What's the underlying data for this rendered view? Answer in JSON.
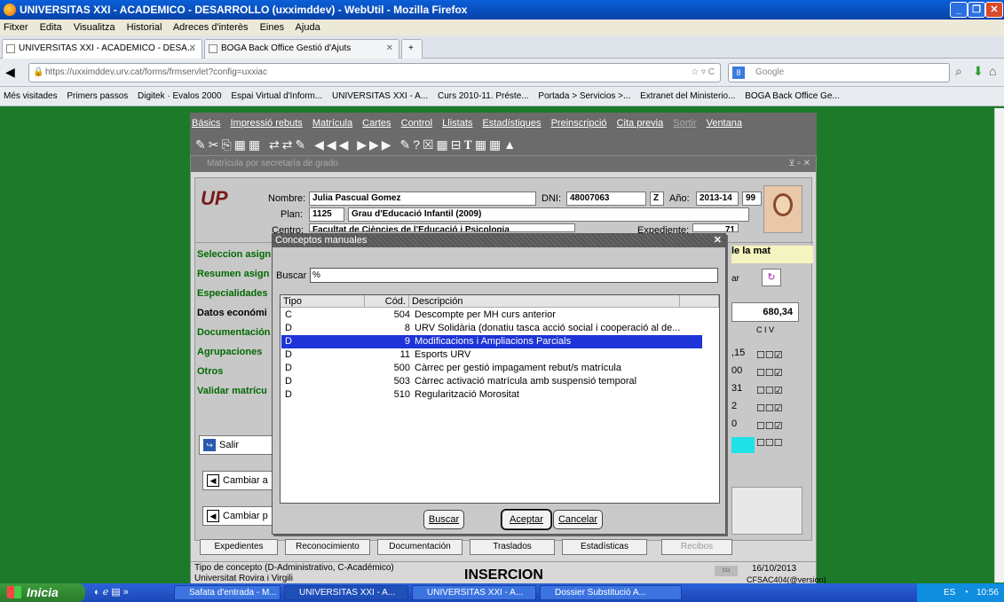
{
  "window": {
    "title": "UNIVERSITAS XXI - ACADEMICO - DESARROLLO (uxximddev) - WebUtil - Mozilla Firefox"
  },
  "browser_menu": [
    "Fitxer",
    "Edita",
    "Visualitza",
    "Historial",
    "Adreces d'interès",
    "Eines",
    "Ajuda"
  ],
  "tabs": [
    {
      "label": "UNIVERSITAS XXI - ACADEMICO - DESA..."
    },
    {
      "label": "BOGA  Back Office Gestió d'Ajuts"
    }
  ],
  "url": "https://uxximddev.urv.cat/forms/frmservlet?config=uxxiac",
  "search_placeholder": "Google",
  "bookmarks": [
    "Més visitades",
    "Primers passos",
    "Digitek · Evalos 2000",
    "Espai Virtual d'Inform...",
    "UNIVERSITAS XXI - A...",
    "Curs 2010-11. Préste...",
    "Portada > Servicios >...",
    "Extranet del Ministerio...",
    "BOGA  Back Office Ge..."
  ],
  "app_menu": [
    "Básics",
    "Impressió rebuts",
    "Matrícula",
    "Cartes",
    "Control",
    "Llistats",
    "Estadístiques",
    "Preinscripció",
    "Cita previa",
    "Sortir",
    "Ventana"
  ],
  "form": {
    "title": "Matrícula por secretaría de grado",
    "nombre_label": "Nombre:",
    "nombre": "Julia Pascual Gomez",
    "dni_label": "DNI:",
    "dni": "48007063",
    "dni_letter": "Z",
    "ano_label": "Año:",
    "ano": "2013-14",
    "ano_extra": "99",
    "plan_label": "Plan:",
    "plan_code": "1125",
    "plan_name": "Grau d'Educació Infantil (2009)",
    "centro_label": "Centro:",
    "centro": "Facultat de Ciències de l'Educació i Psicologia",
    "expediente_label": "Expediente:",
    "expediente": "71",
    "nav_items": [
      "Seleccion asign",
      "Resumen asign",
      "Especialidades",
      "Datos económi",
      "Documentación",
      "Agrupaciones",
      "Otros",
      "Validar matrícu"
    ],
    "right_fragment": "le la mat",
    "amount": "680,34",
    "right_values": [
      ",15",
      "00",
      "31",
      "2",
      "0"
    ],
    "cols": [
      "C",
      "I",
      "V"
    ],
    "salir": "Salir",
    "cambiar1": "Cambiar a",
    "cambiar2": "Cambiar p",
    "right_ar": "ar"
  },
  "bottom_buttons": [
    "Expedientes",
    "Reconocimiento",
    "Documentación",
    "Traslados",
    "Estadísticas",
    "Recibos"
  ],
  "status": {
    "hint": "Tipo de concepto (D-Administrativo, C-Académico)",
    "org": "Universitat Rovira i Virgili",
    "mode": "INSERCION",
    "date": "16/10/2013",
    "badge": "cu",
    "code": "CFSAC404(@version)"
  },
  "dialog": {
    "title": "Conceptos manuales",
    "buscar_label": "Buscar",
    "buscar_value": "%",
    "headers": {
      "tipo": "Tipo",
      "cod": "Cód.",
      "desc": "Descripción"
    },
    "rows": [
      {
        "tipo": "C",
        "cod": "504",
        "desc": "Descompte per MH curs anterior"
      },
      {
        "tipo": "D",
        "cod": "8",
        "desc": "URV Solidària (donatiu tasca acció social i cooperació al de..."
      },
      {
        "tipo": "D",
        "cod": "9",
        "desc": "Modificacions i Ampliacions Parcials"
      },
      {
        "tipo": "D",
        "cod": "11",
        "desc": "Esports URV"
      },
      {
        "tipo": "D",
        "cod": "500",
        "desc": "Càrrec per gestió impagament rebut/s matrícula"
      },
      {
        "tipo": "D",
        "cod": "503",
        "desc": "Càrrec activació matrícula amb suspensió temporal"
      },
      {
        "tipo": "D",
        "cod": "510",
        "desc": "Regularització Morositat"
      }
    ],
    "btn_buscar": "Buscar",
    "btn_aceptar": "Aceptar",
    "btn_cancelar": "Cancelar"
  },
  "taskbar": {
    "start": "Inicia",
    "tasks": [
      "Safata d'entrada - M...",
      "UNIVERSITAS XXI - A...",
      "UNIVERSITAS XXI - A...",
      "Dossier Substitució A..."
    ],
    "lang": "ES",
    "clock": "10:56"
  }
}
